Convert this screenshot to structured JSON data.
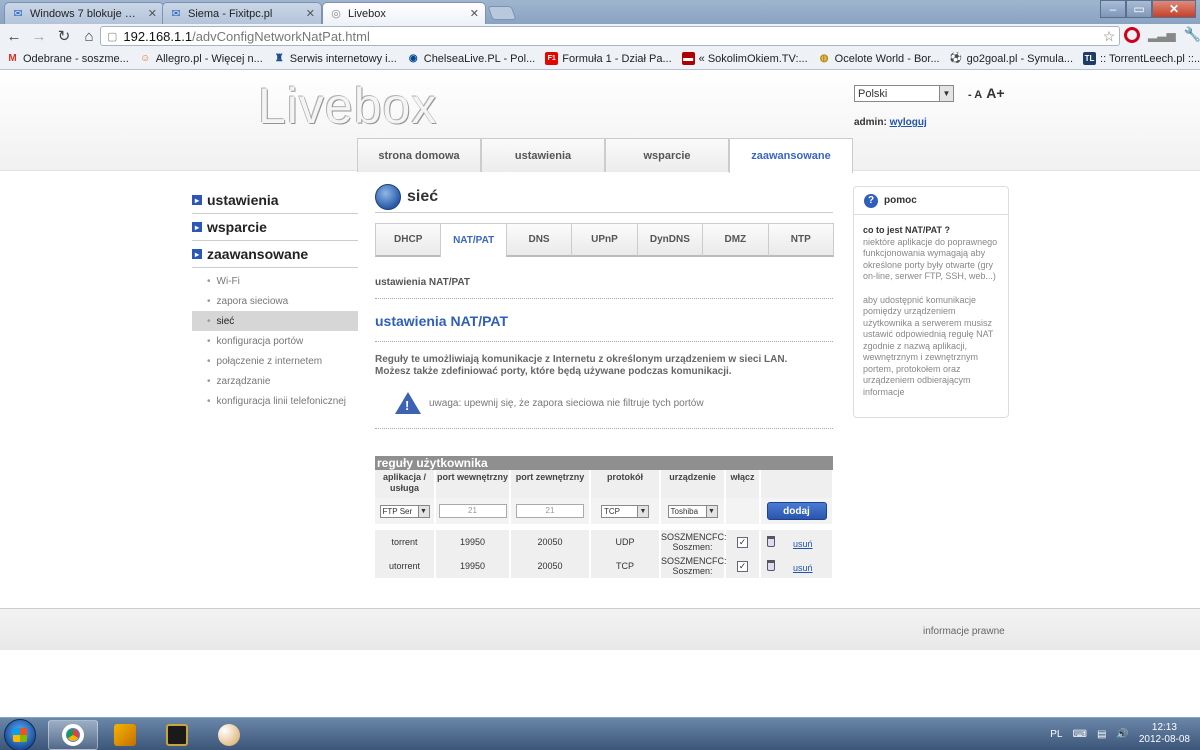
{
  "browser": {
    "tabs": [
      {
        "title": "Windows 7 blokuje mi dost",
        "icon": "forum-icon",
        "active": false
      },
      {
        "title": "Siema - Fixitpc.pl",
        "icon": "forum-icon",
        "active": false
      },
      {
        "title": "Livebox",
        "icon": "globe-icon",
        "active": true
      }
    ],
    "url_host": "192.168.1.1",
    "url_path": "/advConfigNetworkNatPat.html",
    "bookmarks": [
      {
        "label": "Odebrane - soszme...",
        "icon": "gmail-icon",
        "color": "#d93025"
      },
      {
        "label": "Allegro.pl - Więcej n...",
        "icon": "allegro-icon",
        "color": "#f06e1d"
      },
      {
        "label": "Serwis internetowy i...",
        "icon": "bank-icon",
        "color": "#1b4d8f"
      },
      {
        "label": "ChelseaLive.PL - Pol...",
        "icon": "chelsea-icon",
        "color": "#034694"
      },
      {
        "label": "Formuła 1 - Dział Pa...",
        "icon": "f1-icon",
        "color": "#e10600"
      },
      {
        "label": "« SokolimOkiem.TV:...",
        "icon": "sokol-icon",
        "color": "#b00000"
      },
      {
        "label": "Ocelote World - Bor...",
        "icon": "ocelote-icon",
        "color": "#c08a00"
      },
      {
        "label": "go2goal.pl - Symula...",
        "icon": "ball-icon",
        "color": "#2e7d32"
      },
      {
        "label": ":: TorrentLeech.pl ::...",
        "icon": "tl-icon",
        "color": "#1f3b66"
      }
    ]
  },
  "header": {
    "logo": "Livebox",
    "language": "Polski",
    "font_small": "- A",
    "font_large": "A+",
    "admin_label": "admin:",
    "logout": "wyloguj"
  },
  "main_tabs": [
    {
      "label": "strona domowa",
      "active": false
    },
    {
      "label": "ustawienia",
      "active": false
    },
    {
      "label": "wsparcie",
      "active": false
    },
    {
      "label": "zaawansowane",
      "active": true
    }
  ],
  "sidebar": {
    "sections": [
      "ustawienia",
      "wsparcie",
      "zaawansowane"
    ],
    "items": [
      {
        "label": "Wi-Fi",
        "active": false
      },
      {
        "label": "zapora sieciowa",
        "active": false
      },
      {
        "label": "sieć",
        "active": true
      },
      {
        "label": "konfiguracja portów",
        "active": false
      },
      {
        "label": "połączenie z internetem",
        "active": false
      },
      {
        "label": "zarządzanie",
        "active": false
      },
      {
        "label": "konfiguracja linii telefonicznej",
        "active": false
      }
    ]
  },
  "content": {
    "section_title": "sieć",
    "subtabs": [
      {
        "label": "DHCP",
        "active": false
      },
      {
        "label": "NAT/PAT",
        "active": true
      },
      {
        "label": "DNS",
        "active": false
      },
      {
        "label": "UPnP",
        "active": false
      },
      {
        "label": "DynDNS",
        "active": false
      },
      {
        "label": "DMZ",
        "active": false
      },
      {
        "label": "NTP",
        "active": false
      }
    ],
    "breadcrumb": "ustawienia NAT/PAT",
    "heading": "ustawienia NAT/PAT",
    "description": "Reguły te umożliwiają komunikacje z Internetu z określonym urządzeniem w sieci LAN. Możesz także zdefiniować porty, które będą używane podczas komunikacji.",
    "warning": "uwaga: upewnij się, że zapora sieciowa nie filtruje tych portów"
  },
  "rules": {
    "title": "reguły użytkownika",
    "headers": [
      "aplikacja / usługa",
      "port wewnętrzny",
      "port zewnętrzny",
      "protokół",
      "urządzenie",
      "włącz"
    ],
    "form": {
      "app": "FTP Ser",
      "internal_port": "21",
      "external_port": "21",
      "protocol": "TCP",
      "device": "Toshiba",
      "add_label": "dodaj"
    },
    "rows": [
      {
        "app": "torrent",
        "internal": "19950",
        "external": "20050",
        "protocol": "UDP",
        "device": "SOSZMENCFC: Soszmen:",
        "enabled": true,
        "delete": "usuń"
      },
      {
        "app": "utorrent",
        "internal": "19950",
        "external": "20050",
        "protocol": "TCP",
        "device": "SOSZMENCFC: Soszmen:",
        "enabled": true,
        "delete": "usuń"
      }
    ]
  },
  "help": {
    "title": "pomoc",
    "question": "co to jest NAT/PAT ?",
    "p1": "niektóre aplikacje do poprawnego funkcjonowania wymagają aby określone porty były otwarte (gry on-line, serwer FTP, SSH, web...)",
    "p2": "aby udostępnić komunikacje pomiędzy urządzeniem użytkownika a serwerem musisz ustawić odpowiednią regułę NAT zgodnie z nazwą aplikacji, wewnętrznym i zewnętrznym portem, protokołem oraz urządzeniem odbierającym informacje"
  },
  "footer": {
    "legal": "informacje prawne"
  },
  "taskbar": {
    "lang": "PL",
    "time": "12:13",
    "date": "2012-08-08"
  }
}
